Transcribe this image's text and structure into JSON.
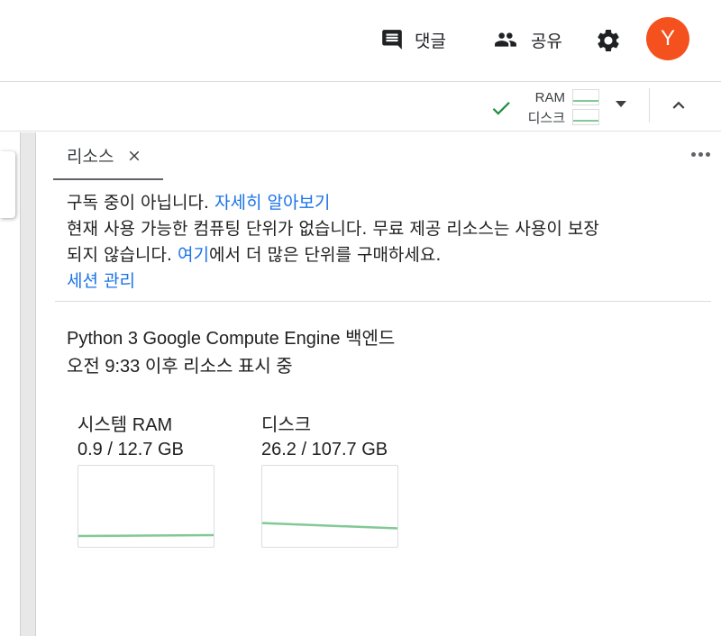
{
  "header": {
    "comment_label": "댓글",
    "share_label": "공유",
    "avatar_letter": "Y",
    "avatar_color": "#f4511e"
  },
  "runtime": {
    "ram_label": "RAM",
    "disk_label": "디스크",
    "status": "connected"
  },
  "panel": {
    "tab_label": "리소스",
    "notice": {
      "line1_text": "구독 중이 아닙니다. ",
      "line1_link": "자세히 알아보기",
      "line2_text": "현재 사용 가능한 컴퓨팅 단위가 없습니다. 무료 제공 리소스는 사용이 보장",
      "line3_pre": "되지 않습니다. ",
      "line3_link": "여기",
      "line3_post": "에서 더 많은 단위를 구매하세요.",
      "manage_sessions": "세션 관리"
    },
    "backend_line": "Python 3 Google Compute Engine 백엔드",
    "since_line": "오전 9:33 이후 리소스 표시 중",
    "gauges": [
      {
        "name": "시스템 RAM",
        "value": "0.9 / 12.7 GB",
        "used": 0.9,
        "total": 12.7,
        "line_color": "#81c995"
      },
      {
        "name": "디스크",
        "value": "26.2 / 107.7 GB",
        "used": 26.2,
        "total": 107.7,
        "line_color": "#81c995"
      }
    ]
  }
}
